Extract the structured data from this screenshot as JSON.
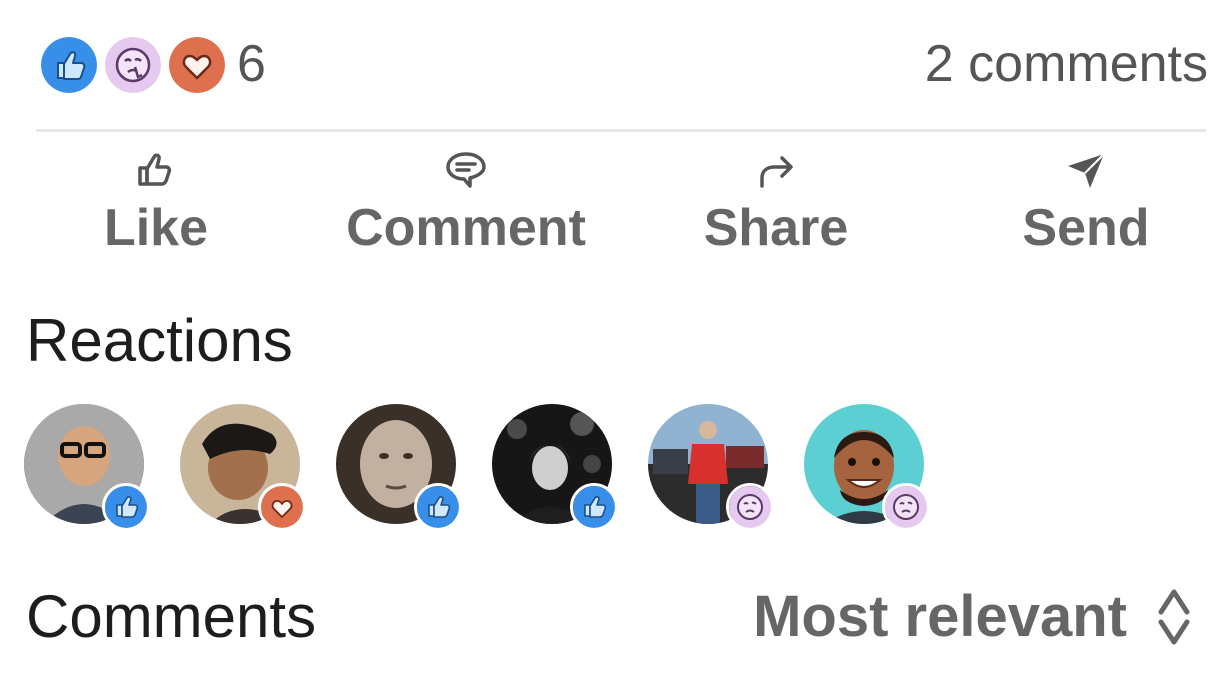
{
  "summary": {
    "reaction_count": "6",
    "comments_count": "2 comments",
    "reaction_icons": [
      "like-icon",
      "insightful-icon",
      "love-icon"
    ]
  },
  "actions": [
    {
      "label": "Like",
      "icon": "thumbs-up-icon"
    },
    {
      "label": "Comment",
      "icon": "comment-bubble-icon"
    },
    {
      "label": "Share",
      "icon": "share-arrow-icon"
    },
    {
      "label": "Send",
      "icon": "paper-plane-icon"
    }
  ],
  "reactions_section": {
    "title": "Reactions",
    "reactors": [
      {
        "reaction": "like"
      },
      {
        "reaction": "love"
      },
      {
        "reaction": "like"
      },
      {
        "reaction": "like"
      },
      {
        "reaction": "insightful"
      },
      {
        "reaction": "insightful"
      }
    ]
  },
  "comments_section": {
    "title": "Comments",
    "sort_label": "Most relevant"
  },
  "colors": {
    "like_blue": "#378fe9",
    "love_orange": "#df704d",
    "insightful_purple": "#d9b8e3",
    "text_gray": "#666666"
  }
}
